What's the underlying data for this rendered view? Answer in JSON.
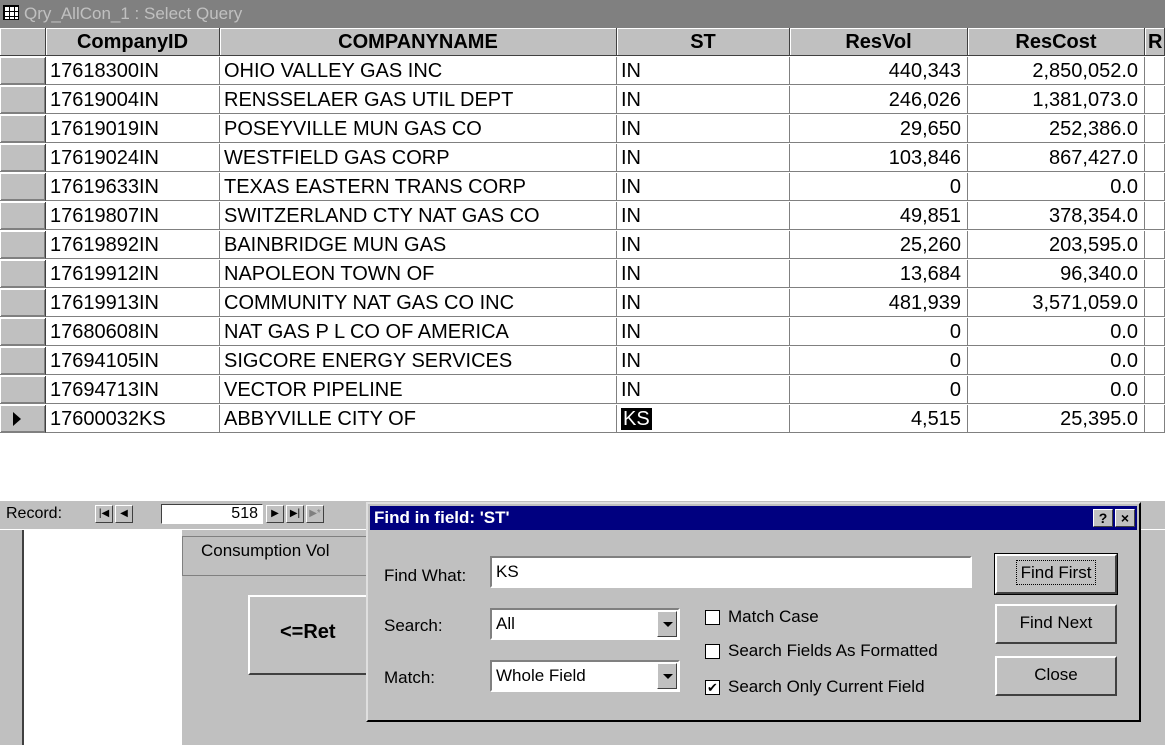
{
  "window": {
    "title": "Qry_AllCon_1 : Select Query"
  },
  "columns": [
    "CompanyID",
    "COMPANYNAME",
    "ST",
    "ResVol",
    "ResCost",
    "R"
  ],
  "rows": [
    [
      "17618300IN",
      "OHIO VALLEY GAS INC",
      "IN",
      "440,343",
      "2,850,052.0"
    ],
    [
      "17619004IN",
      "RENSSELAER GAS UTIL DEPT",
      "IN",
      "246,026",
      "1,381,073.0"
    ],
    [
      "17619019IN",
      "POSEYVILLE MUN GAS CO",
      "IN",
      "29,650",
      "252,386.0"
    ],
    [
      "17619024IN",
      "WESTFIELD GAS CORP",
      "IN",
      "103,846",
      "867,427.0"
    ],
    [
      "17619633IN",
      "TEXAS EASTERN TRANS CORP",
      "IN",
      "0",
      "0.0"
    ],
    [
      "17619807IN",
      "SWITZERLAND CTY NAT GAS CO",
      "IN",
      "49,851",
      "378,354.0"
    ],
    [
      "17619892IN",
      "BAINBRIDGE MUN GAS",
      "IN",
      "25,260",
      "203,595.0"
    ],
    [
      "17619912IN",
      "NAPOLEON TOWN OF",
      "IN",
      "13,684",
      "96,340.0"
    ],
    [
      "17619913IN",
      "COMMUNITY NAT GAS CO INC",
      "IN",
      "481,939",
      "3,571,059.0"
    ],
    [
      "17680608IN",
      "NAT GAS P L CO OF AMERICA",
      "IN",
      "0",
      "0.0"
    ],
    [
      "17694105IN",
      "SIGCORE ENERGY SERVICES",
      "IN",
      "0",
      "0.0"
    ],
    [
      "17694713IN",
      "VECTOR PIPELINE",
      "IN",
      "0",
      "0.0"
    ],
    [
      "17600032KS",
      "ABBYVILLE CITY OF",
      "KS",
      "4,515",
      "25,395.0"
    ]
  ],
  "record_bar": {
    "label": "Record:",
    "value": "518"
  },
  "form": {
    "field_label": "Consumption Vol",
    "button_label": "<=Ret"
  },
  "dialog": {
    "title": "Find in field: 'ST'",
    "help": "?",
    "close_x": "×",
    "find_what_label": "Find What:",
    "find_what_value": "KS",
    "search_label": "Search:",
    "search_value": "All",
    "match_label": "Match:",
    "match_value": "Whole Field",
    "match_case": "Match Case",
    "search_formatted": "Search Fields As Formatted",
    "search_current": "Search Only Current Field",
    "find_first": "Find First",
    "find_next": "Find Next",
    "close": "Close"
  }
}
